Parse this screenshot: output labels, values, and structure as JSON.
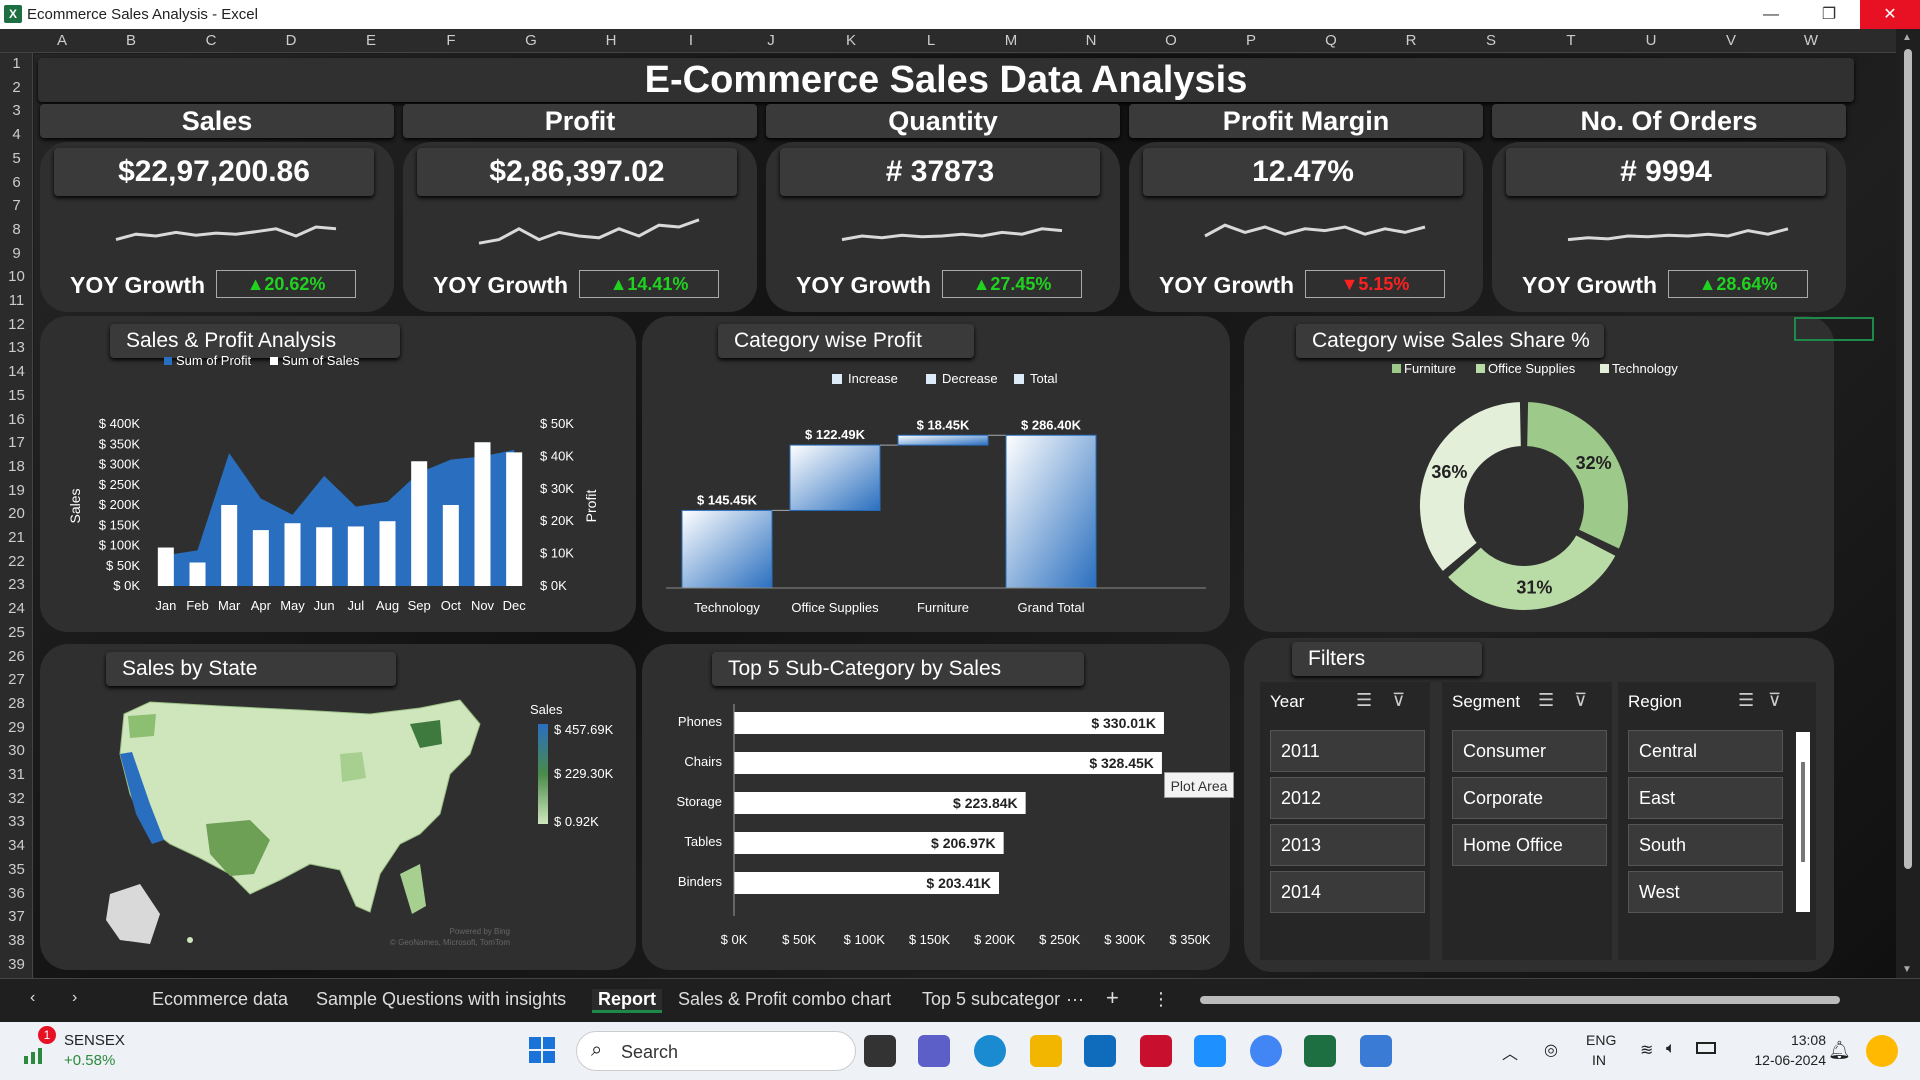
{
  "window": {
    "title": "Ecommerce Sales Analysis - Excel"
  },
  "columns": [
    "A",
    "B",
    "C",
    "D",
    "E",
    "F",
    "G",
    "H",
    "I",
    "J",
    "K",
    "L",
    "M",
    "N",
    "O",
    "P",
    "Q",
    "R",
    "S",
    "T",
    "U",
    "V",
    "W"
  ],
  "rows": [
    "1",
    "2",
    "3",
    "4",
    "5",
    "6",
    "7",
    "8",
    "9",
    "10",
    "11",
    "12",
    "13",
    "14",
    "15",
    "16",
    "17",
    "18",
    "19",
    "20",
    "21",
    "22",
    "23",
    "24",
    "25",
    "26",
    "27",
    "28",
    "29",
    "30",
    "31",
    "32",
    "33",
    "34",
    "35",
    "36",
    "37",
    "38",
    "39"
  ],
  "dashboard": {
    "title": "E-Commerce Sales Data Analysis",
    "yoy_label": "YOY Growth",
    "kpis": [
      {
        "title": "Sales",
        "value": "$22,97,200.86",
        "growth": "▲20.62%",
        "status": "up",
        "spark": [
          0.4,
          0.55,
          0.5,
          0.6,
          0.52,
          0.58,
          0.55,
          0.62,
          0.7,
          0.5,
          0.75,
          0.7
        ]
      },
      {
        "title": "Profit",
        "value": "$2,86,397.02",
        "growth": "▲14.41%",
        "status": "up",
        "spark": [
          0.3,
          0.4,
          0.7,
          0.4,
          0.6,
          0.5,
          0.45,
          0.7,
          0.5,
          0.8,
          0.75,
          0.95
        ]
      },
      {
        "title": "Quantity",
        "value": "# 37873",
        "growth": "▲27.45%",
        "status": "up",
        "spark": [
          0.4,
          0.5,
          0.45,
          0.52,
          0.48,
          0.5,
          0.55,
          0.5,
          0.6,
          0.55,
          0.7,
          0.65
        ]
      },
      {
        "title": "Profit Margin",
        "value": "12.47%",
        "growth": "▼5.15%",
        "status": "down",
        "spark": [
          0.5,
          0.8,
          0.6,
          0.75,
          0.55,
          0.7,
          0.65,
          0.75,
          0.55,
          0.7,
          0.6,
          0.75
        ]
      },
      {
        "title": "No. Of Orders",
        "value": "# 9994",
        "growth": "▲28.64%",
        "status": "up",
        "spark": [
          0.4,
          0.45,
          0.42,
          0.5,
          0.48,
          0.52,
          0.5,
          0.55,
          0.5,
          0.65,
          0.55,
          0.7
        ]
      }
    ],
    "sections": {
      "sales_profit": "Sales & Profit Analysis",
      "category_profit": "Category wise Profit",
      "category_share": "Category wise Sales Share %",
      "state": "Sales by State",
      "top5": "Top 5 Sub-Category by Sales",
      "filters": "Filters"
    },
    "tooltip": "Plot Area",
    "map": {
      "legend_title": "Sales",
      "max": "$ 457.69K",
      "mid": "$ 229.30K",
      "min": "$ 0.92K",
      "watermark": "Powered by Bing\n© GeoNames, Microsoft, TomTom"
    }
  },
  "chart_data": [
    {
      "type": "bar",
      "title": "Sales & Profit Analysis",
      "categories": [
        "Jan",
        "Feb",
        "Mar",
        "Apr",
        "May",
        "Jun",
        "Jul",
        "Aug",
        "Sep",
        "Oct",
        "Nov",
        "Dec"
      ],
      "series": [
        {
          "name": "Sum of Profit",
          "axis": "secondary",
          "values": [
            9500,
            11000,
            41000,
            27000,
            22000,
            34000,
            24500,
            26000,
            35000,
            39000,
            40000,
            42000
          ]
        },
        {
          "name": "Sum of Sales",
          "axis": "primary",
          "values": [
            95000,
            58000,
            200000,
            138000,
            155000,
            145000,
            147000,
            160000,
            308000,
            200000,
            355000,
            330000
          ]
        }
      ],
      "ylabel": "Sales",
      "y2label": "Profit",
      "ylim": [
        0,
        400000
      ],
      "y2lim": [
        0,
        50000
      ],
      "yticks": [
        "$ 0K",
        "$ 50K",
        "$ 100K",
        "$ 150K",
        "$ 200K",
        "$ 250K",
        "$ 300K",
        "$ 350K",
        "$ 400K"
      ],
      "y2ticks": [
        "$ 0K",
        "$ 10K",
        "$ 20K",
        "$ 30K",
        "$ 40K",
        "$ 50K"
      ],
      "legend": "top"
    },
    {
      "type": "bar",
      "subtype": "waterfall",
      "title": "Category wise Profit",
      "categories": [
        "Technology",
        "Office Supplies",
        "Furniture",
        "Grand Total"
      ],
      "values": [
        145.45,
        122.49,
        18.45,
        286.4
      ],
      "labels": [
        "$ 145.45K",
        "$ 122.49K",
        "$ 18.45K",
        "$ 286.40K"
      ],
      "legend_entries": [
        "Increase",
        "Decrease",
        "Total"
      ],
      "legend": "top"
    },
    {
      "type": "pie",
      "subtype": "doughnut",
      "title": "Category wise Sales Share %",
      "categories": [
        "Furniture",
        "Office Supplies",
        "Technology"
      ],
      "values": [
        32,
        31,
        36
      ],
      "labels": [
        "32%",
        "31%",
        "36%"
      ],
      "colors": [
        "#9dc98a",
        "#b9dca6",
        "#e3efd8"
      ],
      "legend": "top"
    },
    {
      "type": "bar",
      "orientation": "horizontal",
      "title": "Top 5 Sub-Category by Sales",
      "categories": [
        "Phones",
        "Chairs",
        "Storage",
        "Tables",
        "Binders"
      ],
      "values": [
        330.01,
        328.45,
        223.84,
        206.97,
        203.41
      ],
      "labels": [
        "$ 330.01K",
        "$ 328.45K",
        "$ 223.84K",
        "$ 206.97K",
        "$ 203.41K"
      ],
      "xlim": [
        0,
        350
      ],
      "xticks": [
        "$ 0K",
        "$ 50K",
        "$ 100K",
        "$ 150K",
        "$ 200K",
        "$ 250K",
        "$ 300K",
        "$ 350K"
      ]
    }
  ],
  "filters": {
    "year": {
      "label": "Year",
      "items": [
        "2011",
        "2012",
        "2013",
        "2014"
      ]
    },
    "segment": {
      "label": "Segment",
      "items": [
        "Consumer",
        "Corporate",
        "Home Office"
      ]
    },
    "region": {
      "label": "Region",
      "items": [
        "Central",
        "East",
        "South",
        "West"
      ]
    }
  },
  "tabs": {
    "items": [
      "Ecommerce data",
      "Sample Questions with insights",
      "Report",
      "Sales & Profit combo chart",
      "Top 5 subcategor"
    ],
    "active": "Report",
    "more": "···",
    "add": "+",
    "menu": "⋮"
  },
  "taskbar": {
    "stock_name": "SENSEX",
    "stock_change": "+0.58%",
    "stock_badge": "1",
    "search": "Search",
    "lang1": "ENG",
    "lang2": "IN",
    "time": "13:08",
    "date": "12-06-2024"
  },
  "colors": {
    "accent_up": "#1fd31f",
    "accent_down": "#ff2020",
    "bar_blue": "#2a6fbf",
    "bar_white": "#ffffff",
    "card": "#2f2f2f"
  }
}
